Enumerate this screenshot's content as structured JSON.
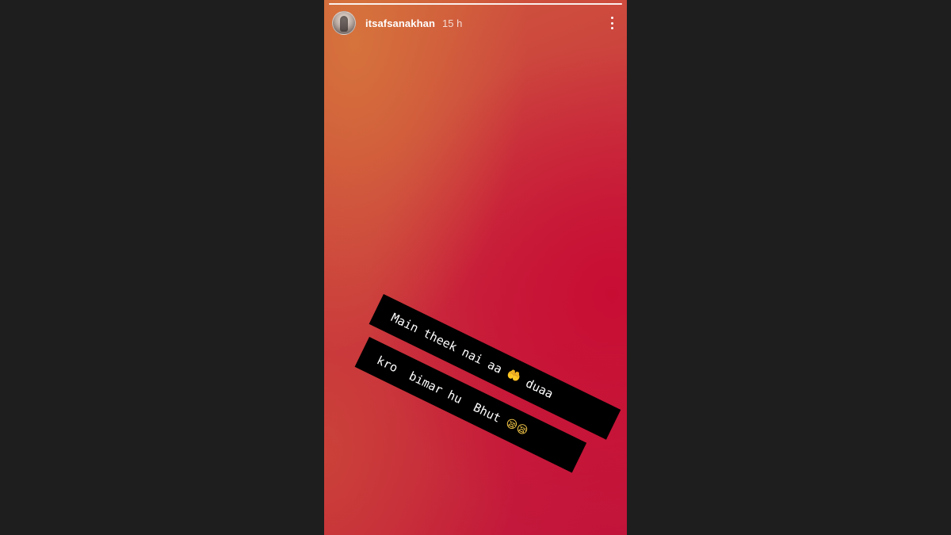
{
  "story": {
    "progress": 1.0,
    "user": {
      "username": "itsafsanakhan",
      "time_ago": "15 h",
      "avatar": "profile-photo"
    },
    "menu_icon": "more-vertical-icon",
    "caption": {
      "line1_text": "Main theek nai aa ",
      "line1_emoji": "🤲",
      "line1_after": " duaa",
      "line2_text": "kro  bimar hu  Bhut ",
      "line2_emoji": "😪😪"
    },
    "colors": {
      "frame_background": "#1e1e1e",
      "story_gradient_top": "#cf5a3c",
      "story_gradient_bottom": "#c2143a",
      "caption_background": "#000000",
      "caption_text": "#ffffff"
    }
  }
}
